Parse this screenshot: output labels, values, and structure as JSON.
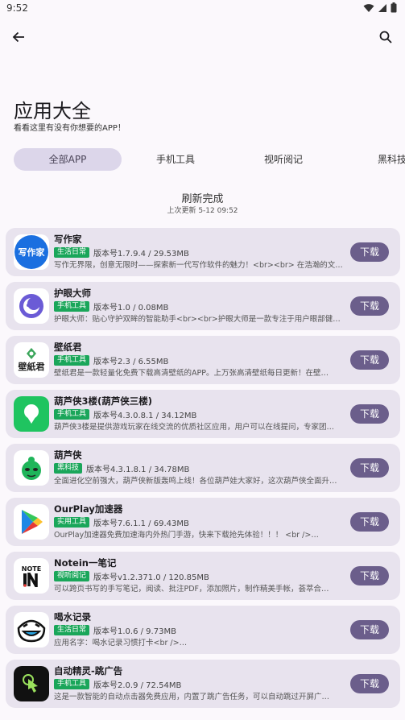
{
  "status": {
    "time": "9:52"
  },
  "header": {
    "title": "应用大全",
    "subtitle": "看看这里有没有你想要的APP！"
  },
  "tabs": [
    "全部APP",
    "手机工具",
    "视听阅记",
    "黑科技"
  ],
  "refresh": {
    "title": "刷新完成",
    "subtitle": "上次更新 5-12 09:52"
  },
  "colors": {
    "accent": "#6b5e8b",
    "tag": "#1aa65a",
    "card": "#e8e3ee"
  },
  "apps": [
    {
      "name": "写作家",
      "tag": "生活日常",
      "version": "版本号1.7.9.4 / 29.53MB",
      "desc": "写作无界限，创意无限时——探索新一代写作软件的魅力！<br><br> 在浩瀚的文字…",
      "button": "下载",
      "icon": "writer-icon",
      "icon_text": "写作家"
    },
    {
      "name": "护眼大师",
      "tag": "手机工具",
      "version": "版本号1.0 / 0.08MB",
      "desc": "护眼大师：贴心守护双眸的智能助手<br><br>护眼大师是一款专注于用户眼部健…",
      "button": "下载",
      "icon": "moon-icon"
    },
    {
      "name": "壁纸君",
      "tag": "手机工具",
      "version": "版本号2.3 / 6.55MB",
      "desc": "壁纸君是一款轻量化免费下载高清壁纸的APP。上万张高清壁纸每日更新！在壁…",
      "button": "下载",
      "icon": "wallpaper-icon",
      "icon_text": "壁紙君"
    },
    {
      "name": "葫芦侠3楼(葫芦侠三楼)",
      "tag": "手机工具",
      "version": "版本号4.3.0.8.1 / 34.12MB",
      "desc": "葫芦侠3楼是提供游戏玩家在线交流的优质社区应用，用户可以在线提问，专家团…",
      "button": "下载",
      "icon": "gourd-icon"
    },
    {
      "name": "葫芦侠",
      "tag": "黑科技",
      "version": "版本号4.3.1.8.1 / 34.78MB",
      "desc": "全面进化空前强大，葫芦侠新版轰鸣上线！各位葫芦娃大家好，这次葫芦侠全面升…",
      "button": "下载",
      "icon": "gourd-mascot-icon"
    },
    {
      "name": "OurPlay加速器",
      "tag": "实用工具",
      "version": "版本号7.6.1.1 / 69.43MB",
      "desc": "OurPlay加速器免费加速海内外热门手游，快来下载抢先体验！！！ <br />…",
      "button": "下载",
      "icon": "play-icon"
    },
    {
      "name": "Notein一笔记",
      "tag": "视听阅记",
      "version": "版本号v1.2.371.0 / 120.85MB",
      "desc": "可以跨页书写的手写笔记，阅读、批注PDF，添加照片，制作精美手帐，荟萃合…",
      "button": "下载",
      "icon": "notein-icon",
      "icon_text": "NOTE"
    },
    {
      "name": "喝水记录",
      "tag": "生活日常",
      "version": "版本号1.0.6 / 9.73MB",
      "desc": "应用名字：喝水记录习惯打卡<br />…",
      "button": "下载",
      "icon": "water-face-icon"
    },
    {
      "name": "自动精灵-跳广告",
      "tag": "手机工具",
      "version": "版本号2.0.9 / 72.54MB",
      "desc": "这是一款智能的自动点击器免费应用，内置了跳广告任务，可以自动跳过开屏广…",
      "button": "下载",
      "icon": "tap-icon"
    }
  ]
}
